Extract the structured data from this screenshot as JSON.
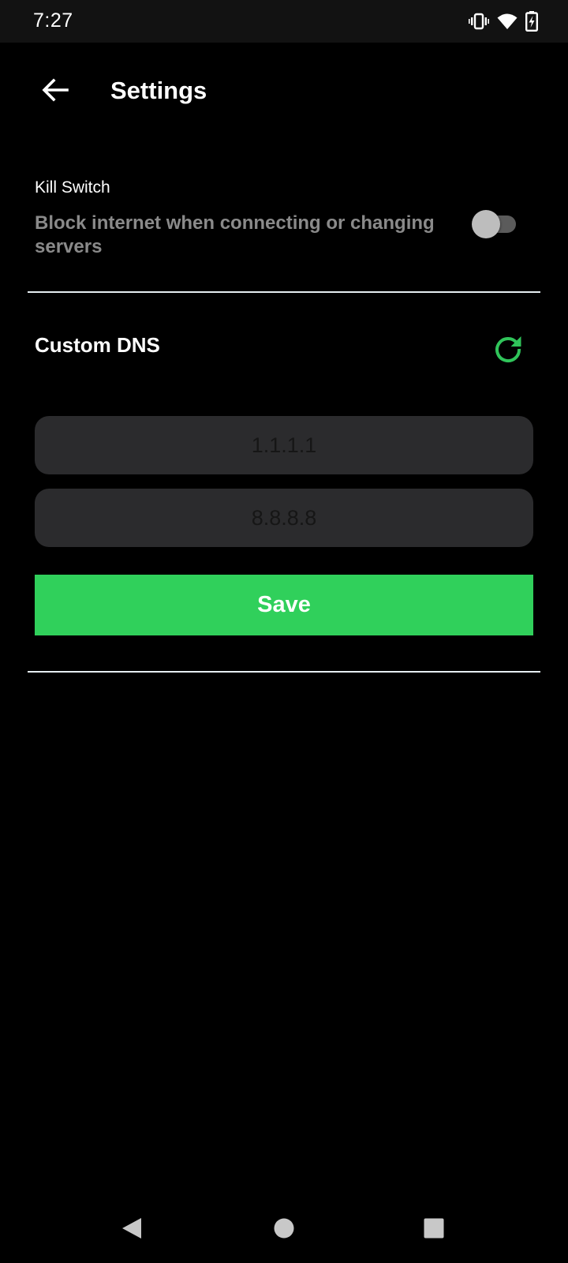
{
  "status_bar": {
    "time": "7:27",
    "icons": [
      "vibrate-icon",
      "wifi-icon",
      "battery-charging-icon"
    ]
  },
  "app_bar": {
    "title": "Settings",
    "back_icon": "arrow-left-icon"
  },
  "kill_switch": {
    "title": "Kill Switch",
    "description": "Block internet when connecting or changing servers",
    "enabled": false
  },
  "custom_dns": {
    "title": "Custom DNS",
    "refresh_icon": "refresh-icon",
    "primary": {
      "value": "",
      "placeholder": "1.1.1.1"
    },
    "secondary": {
      "value": "",
      "placeholder": "8.8.8.8"
    },
    "save_label": "Save"
  },
  "nav_bar": {
    "icons": [
      "nav-back-icon",
      "nav-home-icon",
      "nav-recents-icon"
    ]
  },
  "colors": {
    "background": "#000000",
    "status_bar": "#121212",
    "accent_green": "#30d05b",
    "refresh_green": "#30c45a",
    "input_bg": "#2b2b2d",
    "muted_text": "#8a8a8a",
    "divider": "#e6eef2"
  }
}
